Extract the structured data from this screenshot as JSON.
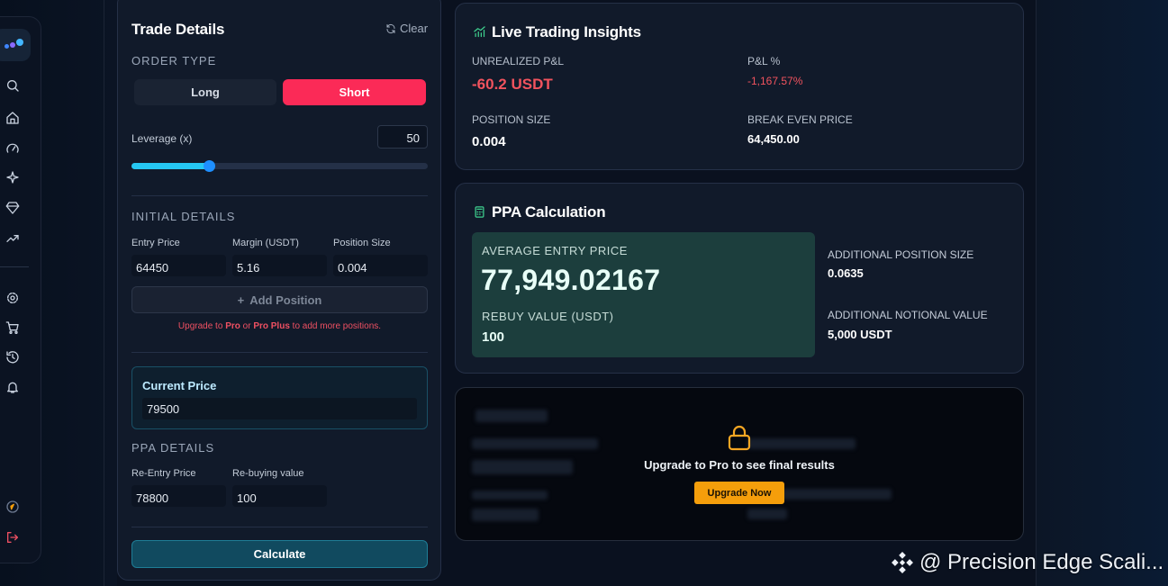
{
  "trade": {
    "title": "Trade Details",
    "clear_label": "Clear",
    "order_type_label": "ORDER TYPE",
    "long_label": "Long",
    "short_label": "Short",
    "leverage_label": "Leverage (x)",
    "leverage_value": "50",
    "leverage_fraction": 0.26,
    "initial_details_label": "INITIAL DETAILS",
    "entry_price_label": "Entry Price",
    "entry_price_value": "64450",
    "margin_label": "Margin (USDT)",
    "margin_value": "5.16",
    "position_size_label": "Position Size",
    "position_size_value": "0.004",
    "add_position_label": "Add Position",
    "upgrade_note_pre": "Upgrade to ",
    "upgrade_note_pro": "Pro",
    "upgrade_note_or": " or ",
    "upgrade_note_pro_plus": "Pro Plus",
    "upgrade_note_post": " to add more positions.",
    "current_price_label": "Current Price",
    "current_price_value": "79500",
    "ppa_details_label": "PPA DETAILS",
    "reentry_price_label": "Re-Entry Price",
    "reentry_price_value": "78800",
    "rebuying_value_label": "Re-buying value",
    "rebuying_value_value": "100",
    "calculate_label": "Calculate"
  },
  "insights": {
    "title": "Live Trading Insights",
    "unrealized_label": "UNREALIZED P&L",
    "unrealized_value": "-60.2 USDT",
    "pnl_pct_label": "P&L %",
    "pnl_pct_value": "-1,167.57%",
    "position_size_label": "POSITION SIZE",
    "position_size_value": "0.004",
    "break_even_label": "BREAK EVEN PRICE",
    "break_even_value": "64,450.00"
  },
  "ppa": {
    "title": "PPA Calculation",
    "avg_entry_label": "AVERAGE ENTRY PRICE",
    "avg_entry_value": "77,949.02167",
    "rebuy_label": "REBUY VALUE (USDT)",
    "rebuy_value": "100",
    "add_pos_size_label": "ADDITIONAL POSITION SIZE",
    "add_pos_size_value": "0.0635",
    "add_notional_label": "ADDITIONAL NOTIONAL VALUE",
    "add_notional_value": "5,000 USDT"
  },
  "locked": {
    "message": "Upgrade to Pro to see final results",
    "button_label": "Upgrade Now"
  },
  "watermark": "@ Precision Edge Scali...",
  "colors": {
    "accent_red": "#fb2a57",
    "accent_cyan": "#25c7f2",
    "accent_orange": "#f59e0b",
    "teal_box": "#1c3e3d"
  },
  "icons": {
    "sidebar": [
      "search-icon",
      "home-icon",
      "gauge-icon",
      "sparkles-icon",
      "gem-icon",
      "trending-up-icon",
      "settings-icon",
      "cart-icon",
      "history-icon",
      "bell-icon",
      "compass-icon",
      "logout-icon"
    ]
  }
}
